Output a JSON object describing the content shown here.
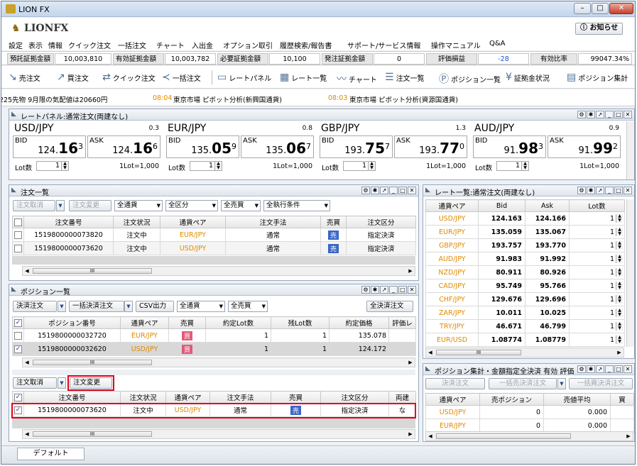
{
  "window": {
    "title": "LION FX"
  },
  "logo": {
    "text": "LIONFX"
  },
  "notice_button": "お知らせ",
  "menu": [
    "設定",
    "表示",
    "情報",
    "クイック注文",
    "一括注文",
    "チャート",
    "入出金",
    "オプション取引",
    "履歴検索/報告書",
    "サポート/サービス情報",
    "操作マニュアル",
    "Q&A"
  ],
  "account": [
    {
      "label": "預託証拠金額",
      "value": "10,003,810"
    },
    {
      "label": "有効証拠金額",
      "value": "10,003,782"
    },
    {
      "label": "必要証拠金額",
      "value": "10,100"
    },
    {
      "label": "発注証拠金額",
      "value": "0"
    },
    {
      "label": "評価損益",
      "value": "-28",
      "color": "#1f4fd6"
    },
    {
      "label": "有効比率",
      "value": "99047.34%"
    }
  ],
  "toolbar": [
    "売注文",
    "買注文",
    "クイック注文",
    "一括注文",
    "レートパネル",
    "レート一覧",
    "チャート",
    "注文一覧",
    "ポジション一覧",
    "証拠金状況",
    "ポジション集計"
  ],
  "news": [
    {
      "time": "",
      "text": "日経225先物 9月限の気配値は20660円"
    },
    {
      "time": "08:04",
      "text": "東京市場 ピボット分析(新興国通貨)"
    },
    {
      "time": "08:03",
      "text": "東京市場 ピボット分析(資源国通貨)"
    }
  ],
  "rate_panel": {
    "title": "レートパネル:通常注文(両建なし)",
    "bid_label": "BID",
    "ask_label": "ASK",
    "lot_label": "Lot数",
    "cards": [
      {
        "pair": "USD/JPY",
        "spread": "0.3",
        "bid_main": "124.",
        "bid_big": "16",
        "bid_sup": "3",
        "ask_main": "124.",
        "ask_big": "16",
        "ask_sup": "6",
        "lot": "1",
        "unit": "1Lot=1,000"
      },
      {
        "pair": "EUR/JPY",
        "spread": "0.8",
        "bid_main": "135.",
        "bid_big": "05",
        "bid_sup": "9",
        "ask_main": "135.",
        "ask_big": "06",
        "ask_sup": "7",
        "lot": "1",
        "unit": "1Lot=1,000"
      },
      {
        "pair": "GBP/JPY",
        "spread": "1.3",
        "bid_main": "193.",
        "bid_big": "75",
        "bid_sup": "7",
        "ask_main": "193.",
        "ask_big": "77",
        "ask_sup": "0",
        "lot": "1",
        "unit": "1Lot=1,000"
      },
      {
        "pair": "AUD/JPY",
        "spread": "0.9",
        "bid_main": "91.",
        "bid_big": "98",
        "bid_sup": "3",
        "ask_main": "91.",
        "ask_big": "99",
        "ask_sup": "2",
        "lot": "1",
        "unit": "1Lot=1,000"
      }
    ]
  },
  "order_list": {
    "title": "注文一覧",
    "buttons": {
      "cancel": "注文取消",
      "modify": "注文変更"
    },
    "filters": [
      "全通貨",
      "全区分",
      "全売買",
      "全執行条件"
    ],
    "headers": [
      "注文番号",
      "注文状況",
      "通貨ペア",
      "注文手法",
      "売買",
      "注文区分"
    ],
    "rows": [
      {
        "id": "1519800000073820",
        "status": "注文中",
        "pair": "EUR/JPY",
        "method": "通常",
        "side": "売",
        "kind": "指定決済"
      },
      {
        "id": "1519800000073620",
        "status": "注文中",
        "pair": "USD/JPY",
        "method": "通常",
        "side": "売",
        "kind": "指定決済"
      }
    ]
  },
  "position_list": {
    "title": "ポジション一覧",
    "buttons": {
      "settle": "決済注文",
      "bulk": "一括決済注文",
      "csv": "CSV出力",
      "all_settle": "全決済注文"
    },
    "filters": [
      "全通貨",
      "全売買"
    ],
    "headers": [
      "ポジション番号",
      "通貨ペア",
      "売買",
      "約定Lot数",
      "残Lot数",
      "約定価格",
      "評価レ"
    ],
    "rows": [
      {
        "id": "1519800000032720",
        "pair": "EUR/JPY",
        "side": "買",
        "lot": "1",
        "remain": "1",
        "price": "135.078",
        "checked": false
      },
      {
        "id": "1519800000032620",
        "pair": "USD/JPY",
        "side": "買",
        "lot": "1",
        "remain": "1",
        "price": "124.172",
        "checked": true
      }
    ],
    "sub_buttons": {
      "cancel": "注文取消",
      "modify": "注文変更"
    },
    "sub_headers": [
      "注文番号",
      "注文状況",
      "通貨ペア",
      "注文手法",
      "売買",
      "注文区分",
      "両建"
    ],
    "sub_rows": [
      {
        "id": "1519800000073620",
        "status": "注文中",
        "pair": "USD/JPY",
        "method": "通常",
        "side": "売",
        "kind": "指定決済",
        "hedge": "な"
      }
    ]
  },
  "rate_list": {
    "title": "レート一覧:通常注文(両建なし)",
    "headers": [
      "通貨ペア",
      "Bid",
      "Ask",
      "Lot数"
    ],
    "rows": [
      {
        "pair": "USD/JPY",
        "bid": "124.163",
        "ask": "124.166",
        "lot": "1"
      },
      {
        "pair": "EUR/JPY",
        "bid": "135.059",
        "ask": "135.067",
        "lot": "1"
      },
      {
        "pair": "GBP/JPY",
        "bid": "193.757",
        "ask": "193.770",
        "lot": "1"
      },
      {
        "pair": "AUD/JPY",
        "bid": "91.983",
        "ask": "91.992",
        "lot": "1"
      },
      {
        "pair": "NZD/JPY",
        "bid": "80.911",
        "ask": "80.926",
        "lot": "1"
      },
      {
        "pair": "CAD/JPY",
        "bid": "95.749",
        "ask": "95.766",
        "lot": "1"
      },
      {
        "pair": "CHF/JPY",
        "bid": "129.676",
        "ask": "129.696",
        "lot": "1"
      },
      {
        "pair": "ZAR/JPY",
        "bid": "10.011",
        "ask": "10.025",
        "lot": "1"
      },
      {
        "pair": "TRY/JPY",
        "bid": "46.671",
        "ask": "46.799",
        "lot": "1"
      },
      {
        "pair": "EUR/USD",
        "bid": "1.08774",
        "ask": "1.08779",
        "lot": "1"
      }
    ]
  },
  "position_summary": {
    "title": "ポジション集計・金額指定全決済 有効 評価",
    "buttons": [
      "決済注文",
      "一括売決済注文",
      "一括買決済注文"
    ],
    "headers": [
      "通貨ペア",
      "売ポジション",
      "売値平均",
      "買"
    ],
    "rows": [
      {
        "pair": "USD/JPY",
        "sell": "0",
        "avg": "0.000"
      },
      {
        "pair": "EUR/JPY",
        "sell": "0",
        "avg": "0.000"
      }
    ]
  },
  "status_tab": "デフォルト",
  "scroll_glyph": "III"
}
